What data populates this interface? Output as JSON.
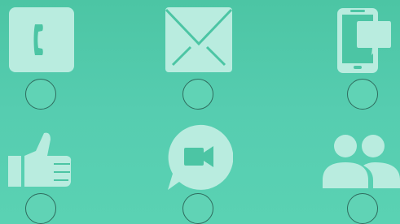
{
  "colors": {
    "background": "#52c9aa",
    "icon_fill": "#b9ecdf",
    "icon_detail": "#4cc5a4",
    "dot_fill": "#60d3b5",
    "dot_border": "#2f6c5e"
  },
  "icons": [
    {
      "name": "phone-icon"
    },
    {
      "name": "envelope-icon"
    },
    {
      "name": "smartphone-chat-icon"
    },
    {
      "name": "thumbs-up-icon"
    },
    {
      "name": "video-chat-icon"
    },
    {
      "name": "group-icon"
    }
  ]
}
